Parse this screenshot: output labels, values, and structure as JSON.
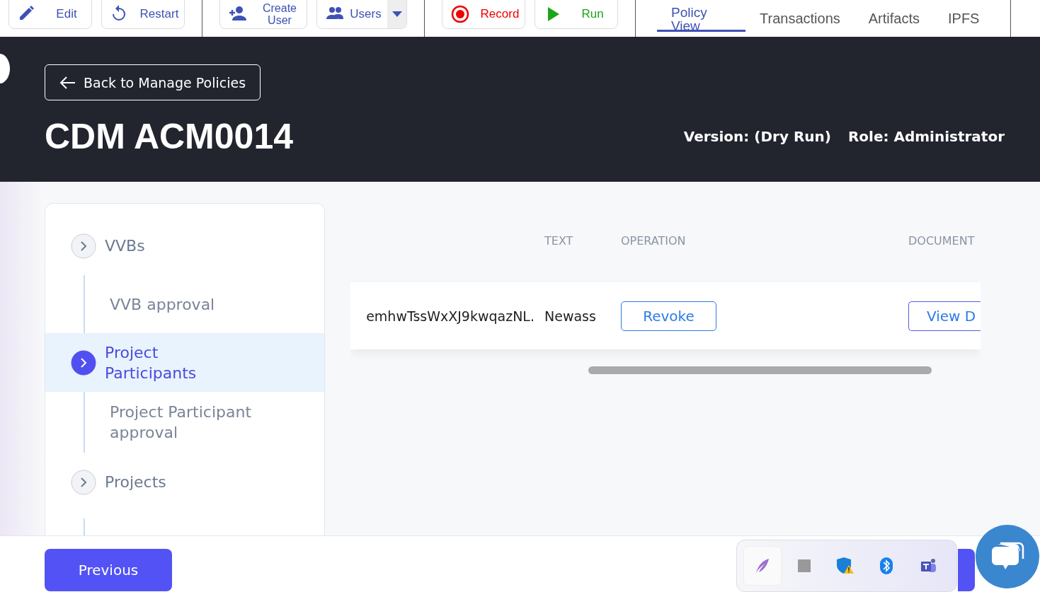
{
  "toolbar": {
    "buttons": [
      {
        "kind": "edit",
        "label": "Edit"
      },
      {
        "kind": "restart",
        "label": "Restart"
      },
      {
        "kind": "add-user",
        "label": "Create User"
      },
      {
        "kind": "users",
        "label": "Users"
      },
      {
        "kind": "record",
        "label": "Record"
      },
      {
        "kind": "run",
        "label": "Run"
      }
    ],
    "tabs": [
      {
        "label": "Policy View",
        "selected": true
      },
      {
        "label": "Transactions",
        "selected": false
      },
      {
        "label": "Artifacts",
        "selected": false
      },
      {
        "label": "IPFS",
        "selected": false
      }
    ]
  },
  "header": {
    "back_link": "Back to Manage Policies",
    "title": "CDM ACM0014",
    "version": "Version: (Dry Run)",
    "role": "Role: Administrator"
  },
  "steps": [
    {
      "label": "VVBs",
      "selected": false,
      "children": [
        {
          "label": "VVB approval"
        }
      ]
    },
    {
      "label": "Project Participants",
      "selected": true,
      "children": [
        {
          "label": "Project Participant approval"
        }
      ]
    },
    {
      "label": "Projects",
      "selected": false
    }
  ],
  "table": {
    "columns": [
      "TEXT",
      "OPERATION",
      "DOCUMENT"
    ],
    "rows": [
      {
        "column_1": "emhwTssWxXJ9kwqazNL.",
        "text": "Newass",
        "operation": "Revoke",
        "document": "View D"
      }
    ]
  },
  "footer": {
    "previous": "Previous"
  }
}
